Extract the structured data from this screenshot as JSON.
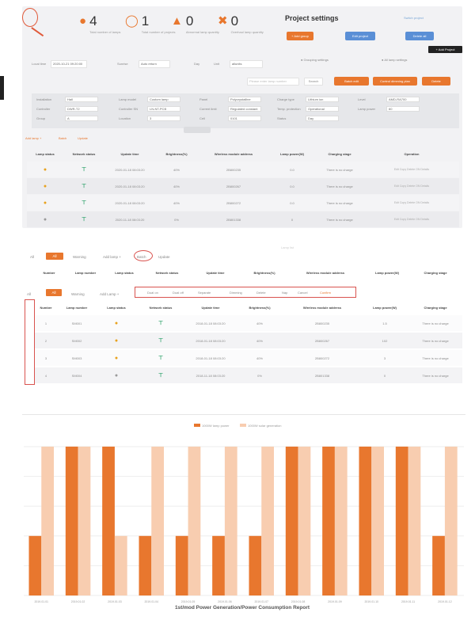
{
  "stats": [
    {
      "icon": "bulb-icon",
      "value": "4",
      "label": "Total number of lamps"
    },
    {
      "icon": "globe-icon",
      "value": "1",
      "label": "Total number of projects"
    },
    {
      "icon": "alarm-icon",
      "value": "0",
      "label": "Abnormal lamp quantity"
    },
    {
      "icon": "tools-icon",
      "value": "0",
      "label": "Overhaul lamp quantity"
    }
  ],
  "project": {
    "title": "Project settings",
    "link": "Switch project",
    "buttons": [
      "+ Add group",
      "Edit project",
      "Delete all"
    ],
    "add_project": "+ Add Project"
  },
  "control": {
    "time_label": "Local time",
    "time_value": "2020-10-21 09:20:00",
    "sunrise_label": "Sunrise",
    "sunrise_value": "Auto return",
    "day_label": "Day",
    "day_value": "",
    "unit_label": "Unit",
    "unit_value": "allunits",
    "radio1": "Grouping settings",
    "radio2": "All lamp settings",
    "search_placeholder": "Please enter lamp number",
    "search_btn": "Search",
    "buttons": [
      "Batch edit",
      "Control dimming plan",
      "Delete"
    ]
  },
  "filters": [
    {
      "label": "Installation",
      "value": "Hall"
    },
    {
      "label": "Lamp model",
      "value": "Custom lamp"
    },
    {
      "label": "Panel",
      "value": "Polycrystalline"
    },
    {
      "label": "Charge type",
      "value": "Lithium ion"
    },
    {
      "label": "Level",
      "value": "AMD-RA700"
    },
    {
      "label": "Controller",
      "value": "DWR-T2"
    },
    {
      "label": "Controller SN",
      "value": "LN-NT-PCB"
    },
    {
      "label": "Current limit",
      "value": "Regulated constant"
    },
    {
      "label": "Temp. protection",
      "value": "Operational"
    },
    {
      "label": "Lamp power",
      "value": "60"
    },
    {
      "label": "Group",
      "value": "A"
    },
    {
      "label": "Location",
      "value": "3"
    },
    {
      "label": "Cell",
      "value": "0101"
    },
    {
      "label": "Status",
      "value": "Day"
    }
  ],
  "links1": {
    "add": "Add lamp +",
    "batch": "Batch",
    "update": "Update"
  },
  "table1": {
    "columns": [
      "Lamp status",
      "Network status",
      "Update time",
      "Brightness(%)",
      "Wireless module address",
      "Lamp power(W)",
      "Charging stage",
      "Operation"
    ],
    "rows": [
      {
        "status": "on",
        "time": "2020-01-18 08:03:20",
        "bright": "40%",
        "addr": "2B800235",
        "power": "0.0",
        "stage": "There is no charge"
      },
      {
        "status": "on",
        "time": "2020-01-18 08:03:20",
        "bright": "40%",
        "addr": "2B800267",
        "power": "0.0",
        "stage": "There is no charge"
      },
      {
        "status": "on",
        "time": "2020-01-18 08:03:20",
        "bright": "40%",
        "addr": "2B800272",
        "power": "0.0",
        "stage": "There is no charge"
      },
      {
        "status": "off",
        "time": "2020-11-18 08:03:20",
        "bright": "0%",
        "addr": "2B801338",
        "power": "0",
        "stage": "There is no charge"
      }
    ],
    "ops": "Edit  Copy  Delete  ON  Details"
  },
  "faint_caption": "Lamp list",
  "section2": {
    "all_label": "All",
    "tab_active": "All",
    "tab_warning": "Warning",
    "add": "Add lamp +",
    "batch": "Batch",
    "update": "Update",
    "columns": [
      "Number",
      "Lamp number",
      "Lamp status",
      "Network status",
      "Update time",
      "Brightness(%)",
      "Wireless module address",
      "Lamp power(W)",
      "Charging stage"
    ]
  },
  "section3": {
    "all_label": "All",
    "tab_active": "All",
    "tab_warning": "Warning",
    "add": "Add Lamp +",
    "actions": [
      "Dual on",
      "Dual off",
      "Separate",
      "Dimming",
      "Delete",
      "Nap",
      "Cancel",
      "Confirm"
    ],
    "columns": [
      "Number",
      "Lamp number",
      "Lamp status",
      "Network status",
      "Update time",
      "Brightness(%)",
      "Wireless module address",
      "Lamp power(W)",
      "Charging stage"
    ],
    "rows": [
      {
        "n": "1",
        "lamp": "SM001",
        "status": "on",
        "time": "2018-01-18 08:03:20",
        "bright": "40%",
        "addr": "2B800235",
        "power": "1.5",
        "stage": "There is no charge"
      },
      {
        "n": "2",
        "lamp": "SM002",
        "status": "on",
        "time": "2018-01-18 08:03:20",
        "bright": "40%",
        "addr": "2B800267",
        "power": "102",
        "stage": "There is no charge"
      },
      {
        "n": "3",
        "lamp": "SM003",
        "status": "on",
        "time": "2018-01-18 08:03:20",
        "bright": "40%",
        "addr": "2B800272",
        "power": "3",
        "stage": "There is no charge"
      },
      {
        "n": "4",
        "lamp": "SM004",
        "status": "off",
        "time": "2018-11-18 08:03:20",
        "bright": "0%",
        "addr": "2B801338",
        "power": "0",
        "stage": "There is no charge"
      }
    ]
  },
  "colors": {
    "accent": "#e8772e",
    "accent_light": "#f8cdb0",
    "blue": "#5a8fd6",
    "alert": "#d9534f"
  },
  "chart_data": {
    "type": "bar",
    "title": "1st/mod Power Generation/Power Consumption Report",
    "legend": [
      "1000W lamp power",
      "1000W solar generation"
    ],
    "legend_position": "top-center",
    "grid": true,
    "categories": [
      "2019.01.01",
      "2019.01.02",
      "2019.01.03",
      "2019.01.04",
      "2019.01.05",
      "2019.01.06",
      "2019.01.07",
      "2019.01.08",
      "2019.01.09",
      "2019.01.10",
      "2019.01.11",
      "2019.01.12"
    ],
    "series": [
      {
        "name": "1000W lamp power",
        "values": [
          40,
          100,
          100,
          40,
          40,
          40,
          40,
          100,
          100,
          100,
          100,
          40
        ]
      },
      {
        "name": "1000W solar generation",
        "values": [
          100,
          100,
          40,
          100,
          100,
          100,
          100,
          100,
          100,
          100,
          100,
          100
        ]
      }
    ],
    "ylim": [
      0,
      100
    ]
  }
}
